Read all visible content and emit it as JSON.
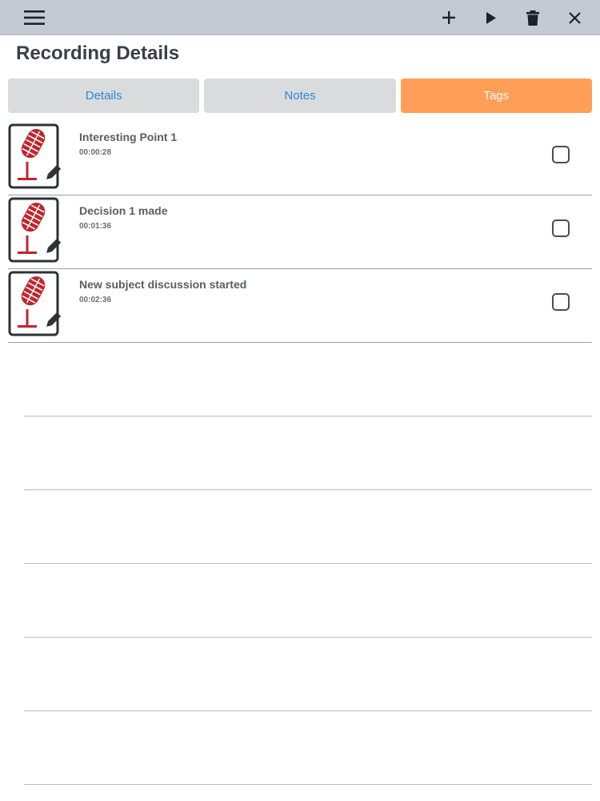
{
  "toolbar": {
    "menu_icon": "hamburger-menu-icon",
    "actions": [
      "add-icon",
      "play-icon",
      "trash-icon",
      "close-icon"
    ]
  },
  "page": {
    "title": "Recording Details"
  },
  "tabs": [
    {
      "label": "Details",
      "active": false
    },
    {
      "label": "Notes",
      "active": false
    },
    {
      "label": "Tags",
      "active": true
    }
  ],
  "tags": [
    {
      "title": "Interesting Point 1",
      "time": "00:00:28",
      "checked": false
    },
    {
      "title": "Decision 1 made",
      "time": "00:01:36",
      "checked": false
    },
    {
      "title": "New subject discussion started",
      "time": "00:02:36",
      "checked": false
    }
  ],
  "colors": {
    "toolbar_bg": "#c4cad3",
    "tab_inactive_bg": "#dadbdd",
    "tab_active_bg": "#ff9f57",
    "tab_text": "#2f86d8",
    "microphone_red": "#c0262d"
  }
}
